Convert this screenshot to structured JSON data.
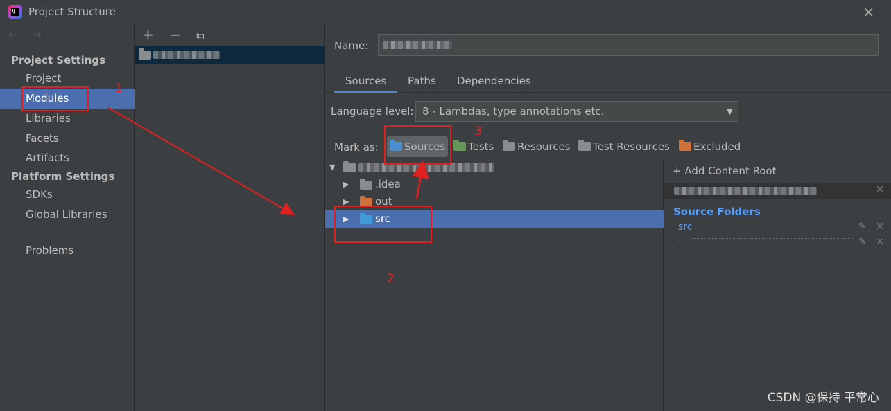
{
  "window": {
    "title": "Project Structure",
    "close_glyph": "✕",
    "icon_text": "IJ"
  },
  "nav": {
    "back_glyph": "←",
    "forward_glyph": "→",
    "project_settings_header": "Project Settings",
    "project_settings_items": [
      "Project",
      "Modules",
      "Libraries",
      "Facets",
      "Artifacts"
    ],
    "platform_settings_header": "Platform Settings",
    "platform_settings_items": [
      "SDKs",
      "Global Libraries"
    ],
    "problems": "Problems",
    "selected": "Modules"
  },
  "modules": {
    "add_glyph": "+",
    "remove_glyph": "−",
    "copy_glyph": "⧉"
  },
  "detail": {
    "name_label": "Name:",
    "tabs": [
      "Sources",
      "Paths",
      "Dependencies"
    ],
    "active_tab": "Sources",
    "language_level_label": "Language level:",
    "language_level_value": "8 - Lambdas, type annotations etc.",
    "mark_as_label": "Mark as:",
    "mark_as": [
      {
        "label": "Sources",
        "color": "#4a8fcf",
        "icon": "sources-folder-icon"
      },
      {
        "label": "Tests",
        "color": "#629755",
        "icon": "tests-folder-icon"
      },
      {
        "label": "Resources",
        "color": "#8a8d90",
        "icon": "resources-folder-icon"
      },
      {
        "label": "Test Resources",
        "color": "#8a8d90",
        "icon": "test-resources-folder-icon"
      },
      {
        "label": "Excluded",
        "color": "#d0703a",
        "icon": "excluded-folder-icon"
      }
    ],
    "tree": [
      {
        "label": ".idea",
        "color": "#8a8d90"
      },
      {
        "label": "out",
        "color": "#d0703a"
      },
      {
        "label": "src",
        "color": "#3d9bd8"
      }
    ],
    "content_roots": {
      "add_label": "+ Add Content Root",
      "source_folders_title": "Source Folders",
      "source_folders": [
        "src",
        "."
      ]
    }
  },
  "annotations": [
    "1",
    "2",
    "3"
  ],
  "watermark": "CSDN @保持 平常心",
  "colors": {
    "accent": "#4b6eaf",
    "annotation_red": "#e02020",
    "link_blue": "#589df6"
  }
}
